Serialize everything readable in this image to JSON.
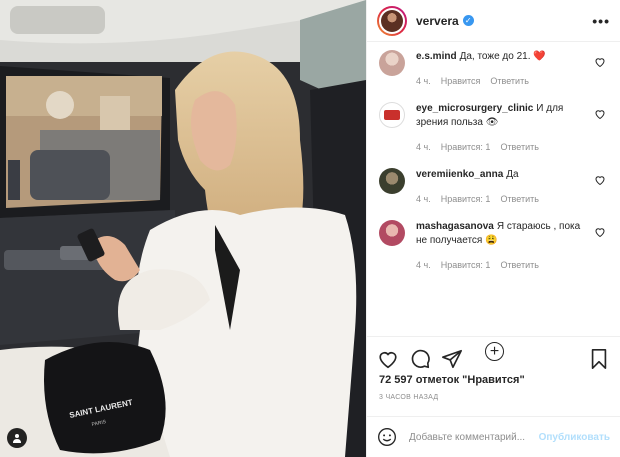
{
  "post": {
    "photo_label": "",
    "brand_on_bag": "SAINT LAURENT",
    "brand_sub": "PARIS"
  },
  "header": {
    "username": "ververa",
    "verified": true,
    "more_glyph": "•••"
  },
  "comments": [
    {
      "user": "e.s.mind",
      "text": "Да, тоже до 21. ❤️",
      "time": "4 ч.",
      "likes": "",
      "reply": "Ответить",
      "like_label": "Нравится",
      "avatar_color": "#c9a39a"
    },
    {
      "user": "eye_microsurgery_clinic",
      "text": "И для зрения польза 👁",
      "time": "4 ч.",
      "likes": "Нравится: 1",
      "reply": "Ответить",
      "avatar_color": "#c9302c"
    },
    {
      "user": "veremiienko_anna",
      "text": "Да",
      "time": "4 ч.",
      "likes": "Нравится: 1",
      "reply": "Ответить",
      "avatar_color": "#3b3f2e"
    },
    {
      "user": "mashagasanova",
      "text": "Я стараюсь , пока не получается 😩",
      "time": "4 ч.",
      "likes": "Нравится: 1",
      "reply": "Ответить",
      "avatar_color": "#b24a62"
    }
  ],
  "load_more_glyph": "+",
  "likes_text": "72 597 отметок \"Нравится\"",
  "time_ago": "3 ЧАСОВ НАЗАД",
  "add_comment": {
    "placeholder": "Добавьте комментарий...",
    "publish": "Опубликовать"
  },
  "colors": {
    "link_disabled": "#b2dffc",
    "verified": "#3897f0",
    "heart": "#ed4956"
  }
}
